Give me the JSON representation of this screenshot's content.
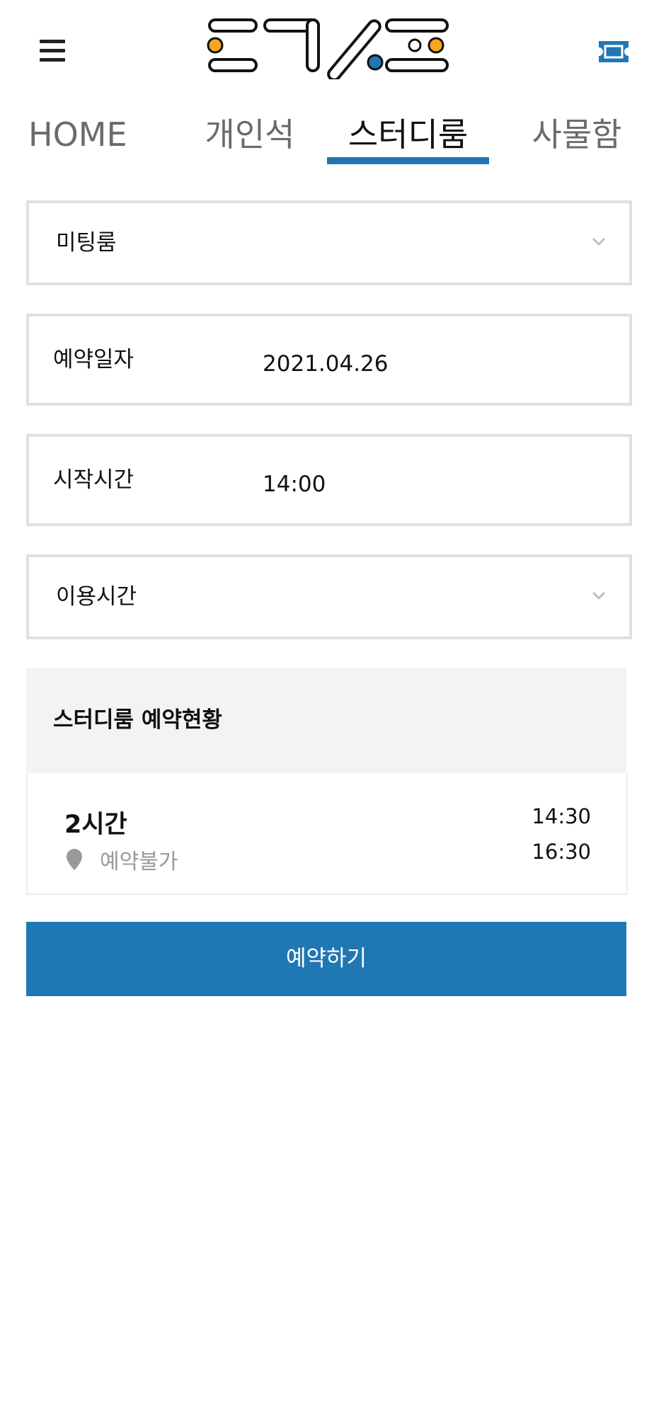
{
  "colors": {
    "accent": "#1f78b4",
    "logo_orange": "#f5a623",
    "logo_blue": "#1f78b4",
    "box_border": "#e0e0e0",
    "muted_text": "#9a9a9a"
  },
  "header": {
    "menu_icon": "hamburger-menu-icon",
    "logo_icon": "brand-logo",
    "ticket_icon": "ticket-icon"
  },
  "tabs": [
    {
      "label": "HOME",
      "active": false
    },
    {
      "label": "개인석",
      "active": false
    },
    {
      "label": "스터디룸",
      "active": true
    },
    {
      "label": "사물함",
      "active": false
    }
  ],
  "form": {
    "room_select": {
      "value": "미팅룸"
    },
    "date": {
      "label": "예약일자",
      "value": "2021.04.26"
    },
    "start_time": {
      "label": "시작시간",
      "value": "14:00"
    },
    "duration_select": {
      "value": "이용시간"
    }
  },
  "status": {
    "title": "스터디룸 예약현황",
    "items": [
      {
        "duration": "2시간",
        "state": "예약불가",
        "start": "14:30",
        "end": "16:30"
      }
    ]
  },
  "reserve_button": {
    "label": "예약하기"
  }
}
